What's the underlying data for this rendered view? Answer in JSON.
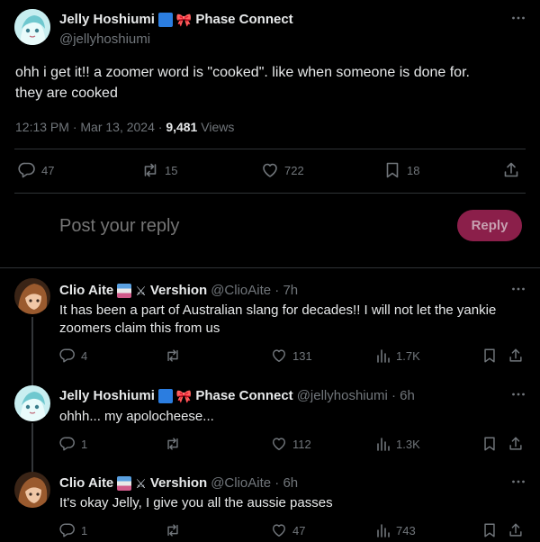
{
  "main_post": {
    "display_name": "Jelly Hoshiumi",
    "affiliation": "Phase Connect",
    "handle": "@jellyhoshiumi",
    "text_line1": "ohh i get it!! a zoomer word is \"cooked\". like when someone is done for.",
    "text_line2": "they are cooked",
    "time": "12:13 PM · Mar 13, 2024 · ",
    "views_count": "9,481",
    "views_label": " Views",
    "replies": "47",
    "reposts": "15",
    "likes": "722",
    "bookmarks": "18"
  },
  "reply_box": {
    "placeholder": "Post your reply",
    "button_label": "Reply"
  },
  "replies": [
    {
      "display_name": "Clio Aite",
      "affiliation": "Vershion",
      "handle_time": "@ClioAite · 7h",
      "text_line1": "It has been a part of Australian slang for decades!! I will not let the yankie",
      "text_line2": "zoomers claim this from us",
      "replies": "4",
      "likes": "131",
      "views": "1.7K"
    },
    {
      "display_name": "Jelly Hoshiumi",
      "affiliation": "Phase Connect",
      "handle_time": "@jellyhoshiumi · 6h",
      "text_line1": "ohhh... my apolocheese...",
      "text_line2": "",
      "replies": "1",
      "likes": "112",
      "views": "1.3K"
    },
    {
      "display_name": "Clio Aite",
      "affiliation": "Vershion",
      "handle_time": "@ClioAite · 6h",
      "text_line1": "It's okay Jelly, I give you all the aussie passes",
      "text_line2": "",
      "replies": "1",
      "likes": "47",
      "views": "743"
    }
  ],
  "colors": {
    "background": "#000000",
    "text": "#e7e9ea",
    "muted": "#71767b",
    "reply_button": "#8b1f4a",
    "divider": "#2f3336"
  }
}
